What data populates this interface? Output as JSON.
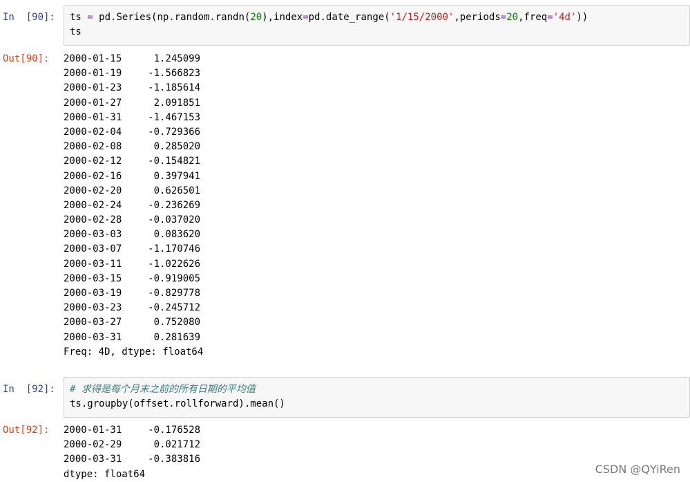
{
  "cells": [
    {
      "in_prompt": "In  [90]:",
      "code_line1": [
        {
          "t": "ts ",
          "c": "name"
        },
        {
          "t": "=",
          "c": "op"
        },
        {
          "t": " pd.Series(np.random.randn(",
          "c": "name"
        },
        {
          "t": "20",
          "c": "num"
        },
        {
          "t": "),index",
          "c": "name"
        },
        {
          "t": "=",
          "c": "op"
        },
        {
          "t": "pd.date_range(",
          "c": "name"
        },
        {
          "t": "'1/15/2000'",
          "c": "str"
        },
        {
          "t": ",periods",
          "c": "name"
        },
        {
          "t": "=",
          "c": "op"
        },
        {
          "t": "20",
          "c": "num"
        },
        {
          "t": ",freq",
          "c": "name"
        },
        {
          "t": "=",
          "c": "op"
        },
        {
          "t": "'4d'",
          "c": "str"
        },
        {
          "t": "))",
          "c": "name"
        }
      ],
      "code_line2": "ts",
      "out_prompt": "Out[90]:",
      "rows": [
        {
          "index": "2000-01-15",
          "value": "1.245099"
        },
        {
          "index": "2000-01-19",
          "value": "-1.566823"
        },
        {
          "index": "2000-01-23",
          "value": "-1.185614"
        },
        {
          "index": "2000-01-27",
          "value": "2.091851"
        },
        {
          "index": "2000-01-31",
          "value": "-1.467153"
        },
        {
          "index": "2000-02-04",
          "value": "-0.729366"
        },
        {
          "index": "2000-02-08",
          "value": "0.285020"
        },
        {
          "index": "2000-02-12",
          "value": "-0.154821"
        },
        {
          "index": "2000-02-16",
          "value": "0.397941"
        },
        {
          "index": "2000-02-20",
          "value": "0.626501"
        },
        {
          "index": "2000-02-24",
          "value": "-0.236269"
        },
        {
          "index": "2000-02-28",
          "value": "-0.037020"
        },
        {
          "index": "2000-03-03",
          "value": "0.083620"
        },
        {
          "index": "2000-03-07",
          "value": "-1.170746"
        },
        {
          "index": "2000-03-11",
          "value": "-1.022626"
        },
        {
          "index": "2000-03-15",
          "value": "-0.919005"
        },
        {
          "index": "2000-03-19",
          "value": "-0.829778"
        },
        {
          "index": "2000-03-23",
          "value": "-0.245712"
        },
        {
          "index": "2000-03-27",
          "value": "0.752080"
        },
        {
          "index": "2000-03-31",
          "value": "0.281639"
        }
      ],
      "footer": "Freq: 4D, dtype: float64"
    },
    {
      "in_prompt": "In  [92]:",
      "comment": "# 求得是每个月末之前的所有日期的平均值",
      "code_line2": "ts.groupby(offset.rollforward).mean()",
      "out_prompt": "Out[92]:",
      "rows": [
        {
          "index": "2000-01-31",
          "value": "-0.176528"
        },
        {
          "index": "2000-02-29",
          "value": "0.021712"
        },
        {
          "index": "2000-03-31",
          "value": "-0.383816"
        }
      ],
      "footer": "dtype: float64"
    }
  ],
  "watermark": "CSDN @QYiRen"
}
